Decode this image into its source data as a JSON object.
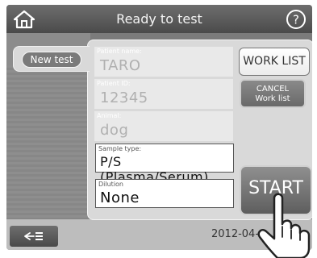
{
  "header": {
    "title": "Ready to test",
    "home_icon": "home-icon",
    "help_icon": "help-icon"
  },
  "tabs": {
    "new_test_label": "New test"
  },
  "fields": {
    "patient_name": {
      "label": "Patient name:",
      "value": "TARO"
    },
    "patient_id": {
      "label": "Patient ID:",
      "value": "12345"
    },
    "animal": {
      "label": "Animal:",
      "value": "dog"
    },
    "sample_type": {
      "label": "Sample type:",
      "value": "P/S (Plasma/Serum)"
    },
    "dilution": {
      "label": "Dilution",
      "value": "None"
    }
  },
  "buttons": {
    "work_list": "WORK LIST",
    "cancel_line1": "CANCEL",
    "cancel_line2": "Work list",
    "start": "START"
  },
  "footer": {
    "date": "2012-04-",
    "back_icon": "back-list-icon"
  },
  "overlay": {
    "hand_icon": "pointing-hand-icon"
  }
}
